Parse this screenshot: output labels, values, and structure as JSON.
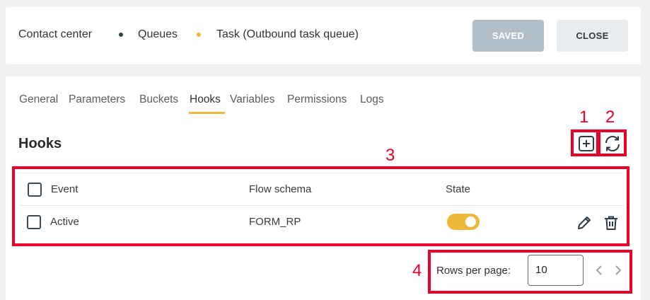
{
  "breadcrumb": {
    "items": [
      "Contact center",
      "Queues",
      "Task (Outbound task queue)"
    ],
    "dot_colors": [
      "#2f4455",
      "#f0b83a"
    ]
  },
  "header_buttons": {
    "saved_label": "SAVED",
    "close_label": "CLOSE"
  },
  "tabs": [
    {
      "label": "General"
    },
    {
      "label": "Parameters"
    },
    {
      "label": "Buckets"
    },
    {
      "label": "Hooks",
      "active": true
    },
    {
      "label": "Variables"
    },
    {
      "label": "Permissions"
    },
    {
      "label": "Logs"
    }
  ],
  "section": {
    "title": "Hooks"
  },
  "toolbar": {
    "add_icon": "add-square-icon",
    "refresh_icon": "refresh-icon"
  },
  "table": {
    "columns": [
      "Event",
      "Flow schema",
      "State"
    ],
    "rows": [
      {
        "event": "Active",
        "flow_schema": "FORM_RP",
        "state": true
      }
    ]
  },
  "pagination": {
    "rows_per_page_label": "Rows per page:",
    "rows_per_page_value": "10"
  },
  "annotations": {
    "labels": [
      "1",
      "2",
      "3",
      "4"
    ],
    "color": "#e8002a"
  },
  "colors": {
    "accent": "#f0b83a",
    "saved_button": "#b2bfc8",
    "close_button": "#e9edef"
  }
}
